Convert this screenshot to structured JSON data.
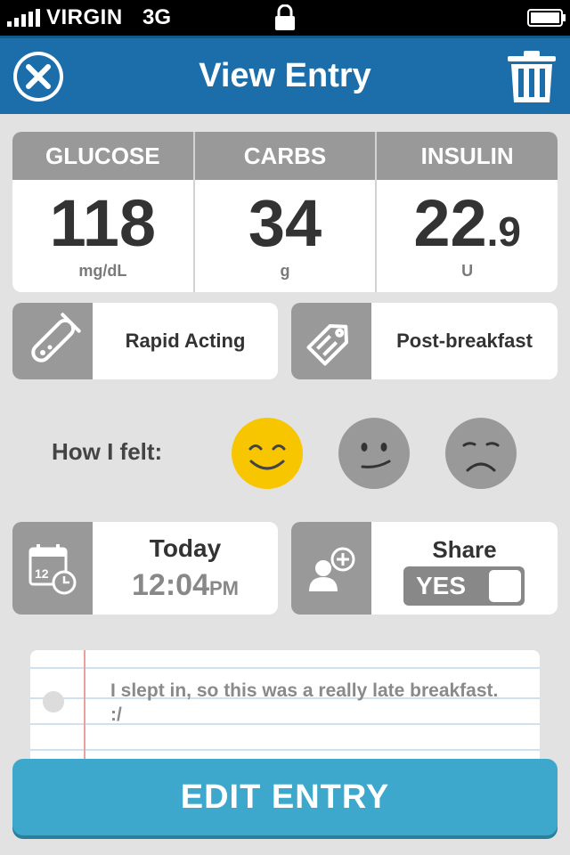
{
  "status_bar": {
    "carrier": "VIRGIN",
    "network": "3G"
  },
  "header": {
    "title": "View Entry"
  },
  "stats": [
    {
      "label": "GLUCOSE",
      "value": "118",
      "decimal": "",
      "unit": "mg/dL"
    },
    {
      "label": "CARBS",
      "value": "34",
      "decimal": "",
      "unit": "g"
    },
    {
      "label": "INSULIN",
      "value": "22",
      "decimal": ".9",
      "unit": "U"
    }
  ],
  "insulin_type": {
    "label": "Rapid Acting"
  },
  "meal_tag": {
    "label": "Post-breakfast"
  },
  "mood": {
    "label": "How I felt:",
    "selected": "happy"
  },
  "datetime": {
    "day": "Today",
    "time": "12:04",
    "ampm": "PM"
  },
  "share": {
    "label": "Share",
    "toggle": "YES"
  },
  "note": {
    "text": "I slept in, so this was a really late breakfast. :/"
  },
  "actions": {
    "edit_label": "EDIT ENTRY"
  },
  "colors": {
    "header": "#1b6ea9",
    "accent": "#3ea7cc",
    "happy_face": "#f7c600",
    "gray_face": "#999999"
  }
}
